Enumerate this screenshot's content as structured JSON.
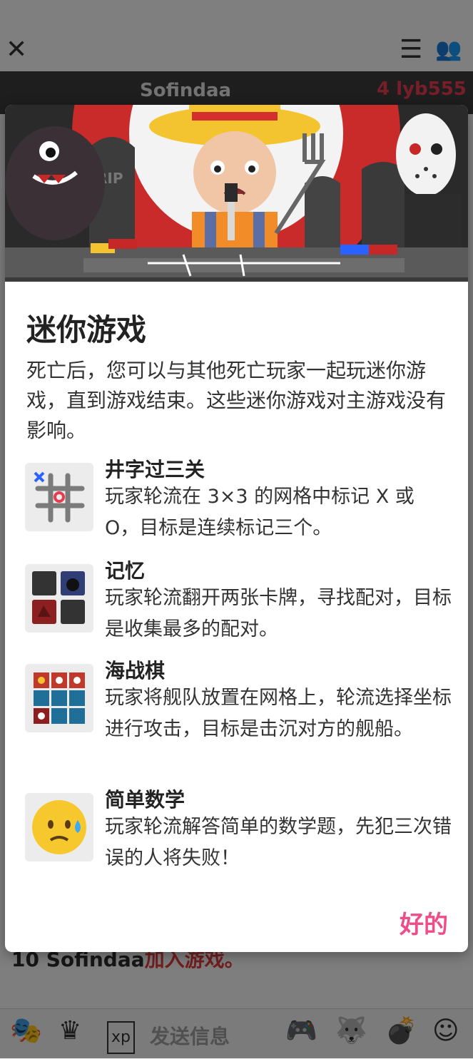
{
  "background": {
    "topbar": {
      "close_icon": "close-icon",
      "menu_icon": "menu-icon",
      "players_icon": "players-icon"
    },
    "strip": {
      "player_name": "Sofindaa",
      "player_tag": "4 lyb555"
    },
    "chat": {
      "player": "10 Sofindaa",
      "message": "加入游戏。"
    },
    "bottombar": {
      "input_placeholder": "发送信息",
      "icons": [
        "mask-icon",
        "crown-icon",
        "xp-icon",
        "gamepad-icon",
        "wolf-icon",
        "grenade-icon",
        "emoji-icon"
      ]
    }
  },
  "modal": {
    "title": "迷你游戏",
    "description": "死亡后，您可以与其他死亡玩家一起玩迷你游戏，直到游戏结束。这些迷你游戏对主游戏没有影响。",
    "games": [
      {
        "name": "井字过三关",
        "description": "玩家轮流在 3×3 的网格中标记 X 或 O，目标是连续标记三个。",
        "icon": "tic-tac-toe-icon"
      },
      {
        "name": "记忆",
        "description": "玩家轮流翻开两张卡牌，寻找配对，目标是收集最多的配对。",
        "icon": "memory-cards-icon"
      },
      {
        "name": "海战棋",
        "description": "玩家将舰队放置在网格上，轮流选择坐标进行攻击，目标是击沉对方的舰船。",
        "icon": "battleship-grid-icon"
      },
      {
        "name": "简单数学",
        "description": "玩家轮流解答简单的数学题，先犯三次错误的人将失败！",
        "icon": "sweating-face-icon"
      }
    ],
    "ok_label": "好的"
  },
  "colors": {
    "accent": "#ee4d8a",
    "overlay": "rgba(0,0,0,0.48)"
  }
}
